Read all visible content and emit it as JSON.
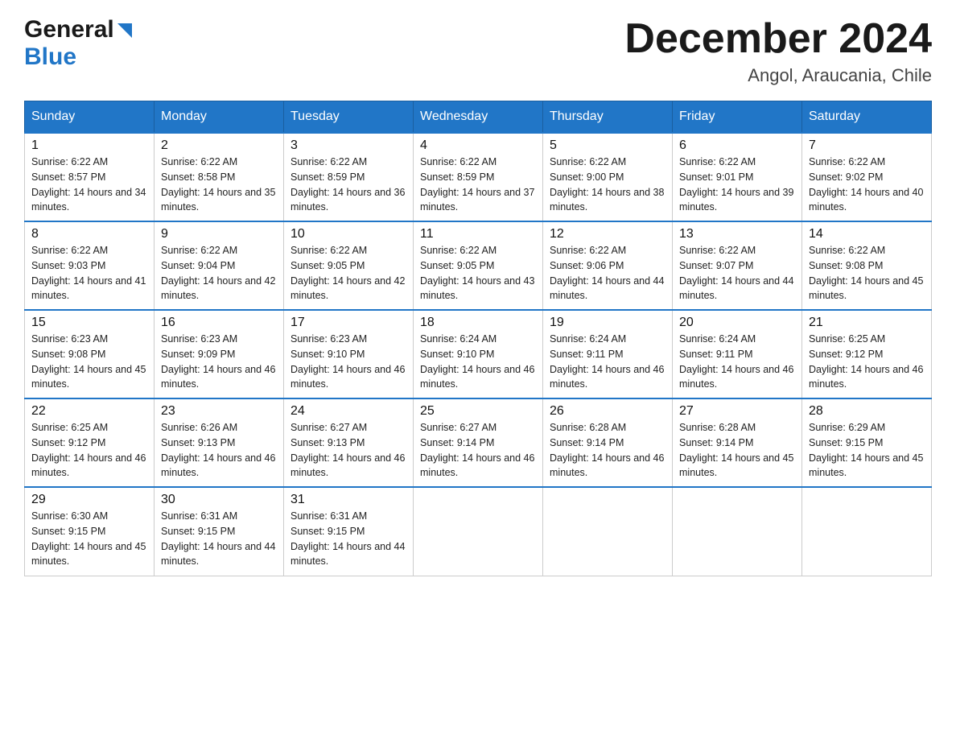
{
  "header": {
    "logo_general": "General",
    "logo_blue": "Blue",
    "title": "December 2024",
    "location": "Angol, Araucania, Chile"
  },
  "days_of_week": [
    "Sunday",
    "Monday",
    "Tuesday",
    "Wednesday",
    "Thursday",
    "Friday",
    "Saturday"
  ],
  "weeks": [
    [
      {
        "day": "1",
        "sunrise": "Sunrise: 6:22 AM",
        "sunset": "Sunset: 8:57 PM",
        "daylight": "Daylight: 14 hours and 34 minutes."
      },
      {
        "day": "2",
        "sunrise": "Sunrise: 6:22 AM",
        "sunset": "Sunset: 8:58 PM",
        "daylight": "Daylight: 14 hours and 35 minutes."
      },
      {
        "day": "3",
        "sunrise": "Sunrise: 6:22 AM",
        "sunset": "Sunset: 8:59 PM",
        "daylight": "Daylight: 14 hours and 36 minutes."
      },
      {
        "day": "4",
        "sunrise": "Sunrise: 6:22 AM",
        "sunset": "Sunset: 8:59 PM",
        "daylight": "Daylight: 14 hours and 37 minutes."
      },
      {
        "day": "5",
        "sunrise": "Sunrise: 6:22 AM",
        "sunset": "Sunset: 9:00 PM",
        "daylight": "Daylight: 14 hours and 38 minutes."
      },
      {
        "day": "6",
        "sunrise": "Sunrise: 6:22 AM",
        "sunset": "Sunset: 9:01 PM",
        "daylight": "Daylight: 14 hours and 39 minutes."
      },
      {
        "day": "7",
        "sunrise": "Sunrise: 6:22 AM",
        "sunset": "Sunset: 9:02 PM",
        "daylight": "Daylight: 14 hours and 40 minutes."
      }
    ],
    [
      {
        "day": "8",
        "sunrise": "Sunrise: 6:22 AM",
        "sunset": "Sunset: 9:03 PM",
        "daylight": "Daylight: 14 hours and 41 minutes."
      },
      {
        "day": "9",
        "sunrise": "Sunrise: 6:22 AM",
        "sunset": "Sunset: 9:04 PM",
        "daylight": "Daylight: 14 hours and 42 minutes."
      },
      {
        "day": "10",
        "sunrise": "Sunrise: 6:22 AM",
        "sunset": "Sunset: 9:05 PM",
        "daylight": "Daylight: 14 hours and 42 minutes."
      },
      {
        "day": "11",
        "sunrise": "Sunrise: 6:22 AM",
        "sunset": "Sunset: 9:05 PM",
        "daylight": "Daylight: 14 hours and 43 minutes."
      },
      {
        "day": "12",
        "sunrise": "Sunrise: 6:22 AM",
        "sunset": "Sunset: 9:06 PM",
        "daylight": "Daylight: 14 hours and 44 minutes."
      },
      {
        "day": "13",
        "sunrise": "Sunrise: 6:22 AM",
        "sunset": "Sunset: 9:07 PM",
        "daylight": "Daylight: 14 hours and 44 minutes."
      },
      {
        "day": "14",
        "sunrise": "Sunrise: 6:22 AM",
        "sunset": "Sunset: 9:08 PM",
        "daylight": "Daylight: 14 hours and 45 minutes."
      }
    ],
    [
      {
        "day": "15",
        "sunrise": "Sunrise: 6:23 AM",
        "sunset": "Sunset: 9:08 PM",
        "daylight": "Daylight: 14 hours and 45 minutes."
      },
      {
        "day": "16",
        "sunrise": "Sunrise: 6:23 AM",
        "sunset": "Sunset: 9:09 PM",
        "daylight": "Daylight: 14 hours and 46 minutes."
      },
      {
        "day": "17",
        "sunrise": "Sunrise: 6:23 AM",
        "sunset": "Sunset: 9:10 PM",
        "daylight": "Daylight: 14 hours and 46 minutes."
      },
      {
        "day": "18",
        "sunrise": "Sunrise: 6:24 AM",
        "sunset": "Sunset: 9:10 PM",
        "daylight": "Daylight: 14 hours and 46 minutes."
      },
      {
        "day": "19",
        "sunrise": "Sunrise: 6:24 AM",
        "sunset": "Sunset: 9:11 PM",
        "daylight": "Daylight: 14 hours and 46 minutes."
      },
      {
        "day": "20",
        "sunrise": "Sunrise: 6:24 AM",
        "sunset": "Sunset: 9:11 PM",
        "daylight": "Daylight: 14 hours and 46 minutes."
      },
      {
        "day": "21",
        "sunrise": "Sunrise: 6:25 AM",
        "sunset": "Sunset: 9:12 PM",
        "daylight": "Daylight: 14 hours and 46 minutes."
      }
    ],
    [
      {
        "day": "22",
        "sunrise": "Sunrise: 6:25 AM",
        "sunset": "Sunset: 9:12 PM",
        "daylight": "Daylight: 14 hours and 46 minutes."
      },
      {
        "day": "23",
        "sunrise": "Sunrise: 6:26 AM",
        "sunset": "Sunset: 9:13 PM",
        "daylight": "Daylight: 14 hours and 46 minutes."
      },
      {
        "day": "24",
        "sunrise": "Sunrise: 6:27 AM",
        "sunset": "Sunset: 9:13 PM",
        "daylight": "Daylight: 14 hours and 46 minutes."
      },
      {
        "day": "25",
        "sunrise": "Sunrise: 6:27 AM",
        "sunset": "Sunset: 9:14 PM",
        "daylight": "Daylight: 14 hours and 46 minutes."
      },
      {
        "day": "26",
        "sunrise": "Sunrise: 6:28 AM",
        "sunset": "Sunset: 9:14 PM",
        "daylight": "Daylight: 14 hours and 46 minutes."
      },
      {
        "day": "27",
        "sunrise": "Sunrise: 6:28 AM",
        "sunset": "Sunset: 9:14 PM",
        "daylight": "Daylight: 14 hours and 45 minutes."
      },
      {
        "day": "28",
        "sunrise": "Sunrise: 6:29 AM",
        "sunset": "Sunset: 9:15 PM",
        "daylight": "Daylight: 14 hours and 45 minutes."
      }
    ],
    [
      {
        "day": "29",
        "sunrise": "Sunrise: 6:30 AM",
        "sunset": "Sunset: 9:15 PM",
        "daylight": "Daylight: 14 hours and 45 minutes."
      },
      {
        "day": "30",
        "sunrise": "Sunrise: 6:31 AM",
        "sunset": "Sunset: 9:15 PM",
        "daylight": "Daylight: 14 hours and 44 minutes."
      },
      {
        "day": "31",
        "sunrise": "Sunrise: 6:31 AM",
        "sunset": "Sunset: 9:15 PM",
        "daylight": "Daylight: 14 hours and 44 minutes."
      },
      null,
      null,
      null,
      null
    ]
  ]
}
